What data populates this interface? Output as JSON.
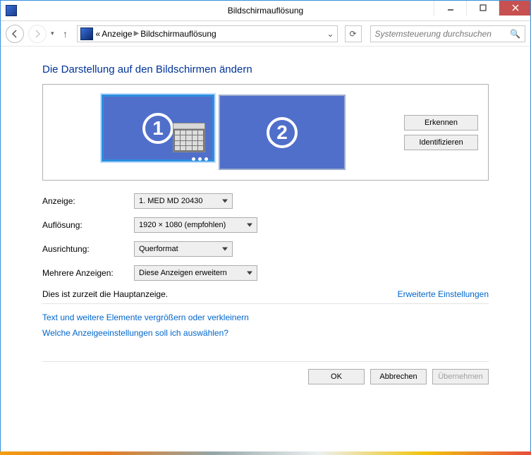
{
  "titlebar": {
    "title": "Bildschirmauflösung"
  },
  "breadcrumb": {
    "prefix": "«",
    "item1": "Anzeige",
    "item2": "Bildschirmauflösung"
  },
  "search": {
    "placeholder": "Systemsteuerung durchsuchen"
  },
  "heading": "Die Darstellung auf den Bildschirmen ändern",
  "displays": {
    "one": "1",
    "two": "2"
  },
  "buttons": {
    "detect": "Erkennen",
    "identify": "Identifizieren",
    "ok": "OK",
    "cancel": "Abbrechen",
    "apply": "Übernehmen"
  },
  "labels": {
    "display": "Anzeige:",
    "resolution": "Auflösung:",
    "orientation": "Ausrichtung:",
    "multiple": "Mehrere Anzeigen:"
  },
  "values": {
    "display": "1. MED MD 20430",
    "resolution": "1920 × 1080 (empfohlen)",
    "orientation": "Querformat",
    "multiple": "Diese Anzeigen erweitern"
  },
  "status": {
    "main": "Dies ist zurzeit die Hauptanzeige.",
    "advanced": "Erweiterte Einstellungen"
  },
  "links": {
    "resize": "Text und weitere Elemente vergrößern oder verkleinern",
    "help": "Welche Anzeigeeinstellungen soll ich auswählen?"
  }
}
